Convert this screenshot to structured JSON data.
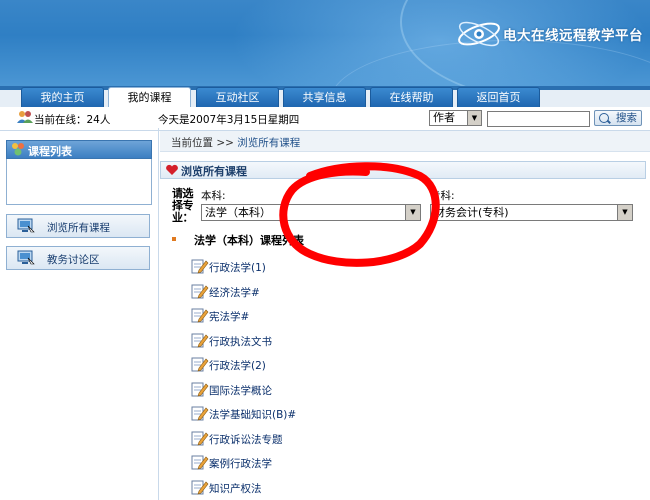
{
  "header": {
    "site_title": "电大在线远程教学平台"
  },
  "nav": {
    "tabs": [
      {
        "label": "我的主页",
        "active": false
      },
      {
        "label": "我的课程",
        "active": true
      },
      {
        "label": "互动社区",
        "active": false
      },
      {
        "label": "共享信息",
        "active": false
      },
      {
        "label": "在线帮助",
        "active": false
      },
      {
        "label": "返回首页",
        "active": false
      }
    ]
  },
  "infobar": {
    "online_text": "当前在线：24人",
    "date_text": "今天是2007年3月15日星期四",
    "search_type": "作者",
    "search_value": "",
    "search_button": "搜索"
  },
  "sidebar": {
    "panel_title": "课程列表",
    "links": [
      {
        "label": "浏览所有课程"
      },
      {
        "label": "教务讨论区"
      }
    ]
  },
  "breadcrumb": {
    "prefix": "当前位置",
    "separator": ">>",
    "current": "浏览所有课程"
  },
  "section": {
    "title": "浏览所有课程",
    "choose_label": "请选择专业：",
    "ben_label": "本科:",
    "ben_selected": "法学（本科）",
    "zhuan_label": "专科:",
    "zhuan_selected": "财务会计(专科)",
    "list_title": "法学（本科）课程列表"
  },
  "courses": [
    "行政法学(1)",
    "经济法学#",
    "宪法学#",
    "行政执法文书",
    "行政法学(2)",
    "国际法学概论",
    "法学基础知识(B)#",
    "行政诉讼法专题",
    "案例行政法学",
    "知识产权法"
  ],
  "colors": {
    "header_blue": "#2f7fc4",
    "tab_blue": "#1f66b0",
    "annotation_red": "#ff0000",
    "heart_red": "#d41f2a",
    "bullet_orange": "#e07a20"
  }
}
